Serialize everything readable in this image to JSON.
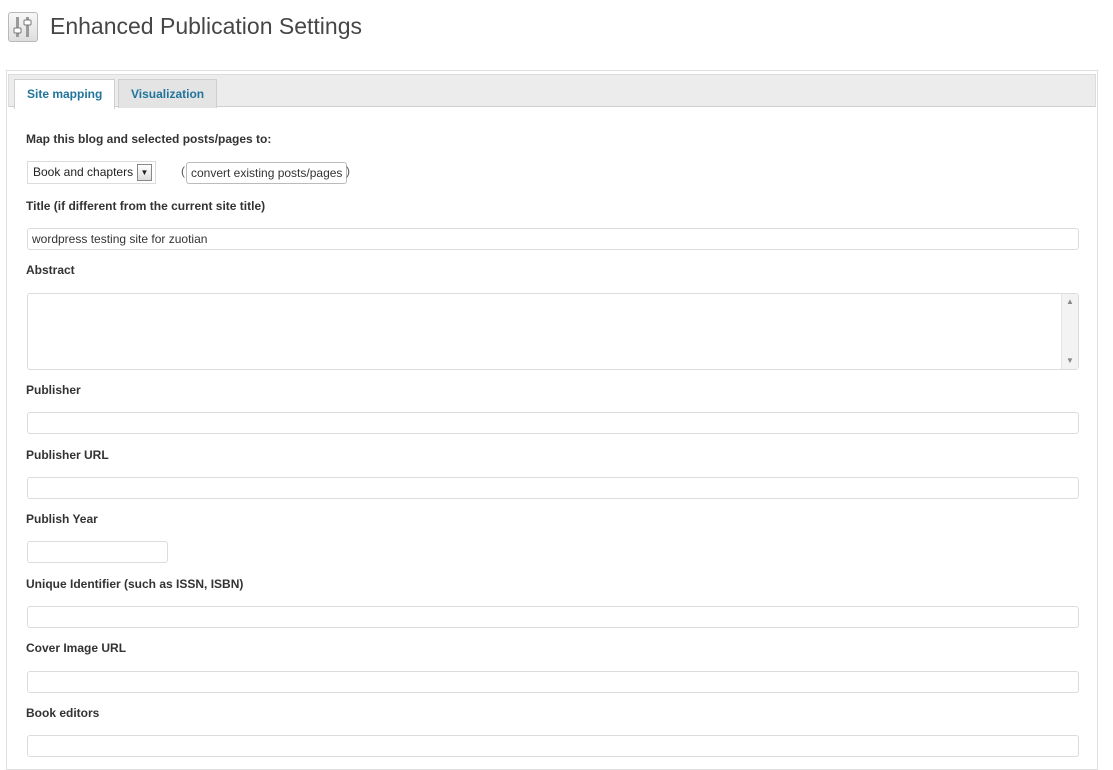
{
  "header": {
    "title": "Enhanced Publication Settings",
    "icon": "settings-sliders-icon"
  },
  "tabs": [
    {
      "label": "Site mapping",
      "active": true
    },
    {
      "label": "Visualization",
      "active": false
    }
  ],
  "form": {
    "map_label": "Map this blog and selected posts/pages to:",
    "map_select_value": "Book and chapters",
    "paren_open": "(",
    "paren_close": ")",
    "convert_button": "convert existing posts/pages",
    "title_label": "Title (if different from the current site title)",
    "title_value": "wordpress testing site for zuotian",
    "abstract_label": "Abstract",
    "abstract_value": "",
    "publisher_label": "Publisher",
    "publisher_value": "",
    "publisher_url_label": "Publisher URL",
    "publisher_url_value": "",
    "publish_year_label": "Publish Year",
    "publish_year_value": "",
    "identifier_label": "Unique Identifier (such as ISSN, ISBN)",
    "identifier_value": "",
    "cover_label": "Cover Image URL",
    "cover_value": "",
    "editors_label": "Book editors",
    "editors_value": ""
  },
  "colors": {
    "link": "#21759b",
    "tab_bg": "#ececec"
  }
}
